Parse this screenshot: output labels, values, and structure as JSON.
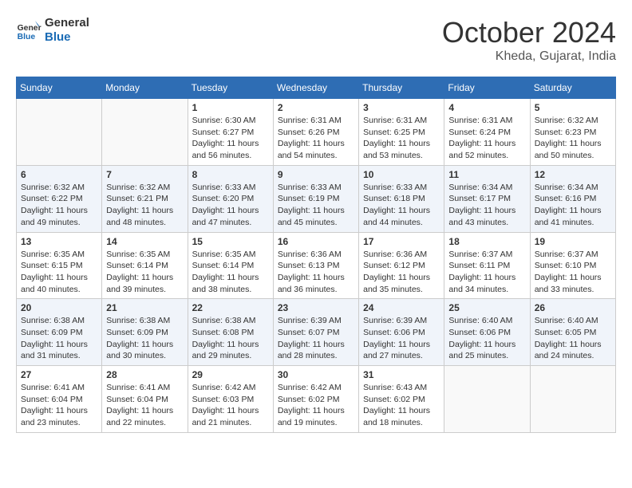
{
  "header": {
    "logo_general": "General",
    "logo_blue": "Blue",
    "month_title": "October 2024",
    "location": "Kheda, Gujarat, India"
  },
  "weekdays": [
    "Sunday",
    "Monday",
    "Tuesday",
    "Wednesday",
    "Thursday",
    "Friday",
    "Saturday"
  ],
  "weeks": [
    [
      {
        "day": "",
        "sunrise": "",
        "sunset": "",
        "daylight": ""
      },
      {
        "day": "",
        "sunrise": "",
        "sunset": "",
        "daylight": ""
      },
      {
        "day": "1",
        "sunrise": "Sunrise: 6:30 AM",
        "sunset": "Sunset: 6:27 PM",
        "daylight": "Daylight: 11 hours and 56 minutes."
      },
      {
        "day": "2",
        "sunrise": "Sunrise: 6:31 AM",
        "sunset": "Sunset: 6:26 PM",
        "daylight": "Daylight: 11 hours and 54 minutes."
      },
      {
        "day": "3",
        "sunrise": "Sunrise: 6:31 AM",
        "sunset": "Sunset: 6:25 PM",
        "daylight": "Daylight: 11 hours and 53 minutes."
      },
      {
        "day": "4",
        "sunrise": "Sunrise: 6:31 AM",
        "sunset": "Sunset: 6:24 PM",
        "daylight": "Daylight: 11 hours and 52 minutes."
      },
      {
        "day": "5",
        "sunrise": "Sunrise: 6:32 AM",
        "sunset": "Sunset: 6:23 PM",
        "daylight": "Daylight: 11 hours and 50 minutes."
      }
    ],
    [
      {
        "day": "6",
        "sunrise": "Sunrise: 6:32 AM",
        "sunset": "Sunset: 6:22 PM",
        "daylight": "Daylight: 11 hours and 49 minutes."
      },
      {
        "day": "7",
        "sunrise": "Sunrise: 6:32 AM",
        "sunset": "Sunset: 6:21 PM",
        "daylight": "Daylight: 11 hours and 48 minutes."
      },
      {
        "day": "8",
        "sunrise": "Sunrise: 6:33 AM",
        "sunset": "Sunset: 6:20 PM",
        "daylight": "Daylight: 11 hours and 47 minutes."
      },
      {
        "day": "9",
        "sunrise": "Sunrise: 6:33 AM",
        "sunset": "Sunset: 6:19 PM",
        "daylight": "Daylight: 11 hours and 45 minutes."
      },
      {
        "day": "10",
        "sunrise": "Sunrise: 6:33 AM",
        "sunset": "Sunset: 6:18 PM",
        "daylight": "Daylight: 11 hours and 44 minutes."
      },
      {
        "day": "11",
        "sunrise": "Sunrise: 6:34 AM",
        "sunset": "Sunset: 6:17 PM",
        "daylight": "Daylight: 11 hours and 43 minutes."
      },
      {
        "day": "12",
        "sunrise": "Sunrise: 6:34 AM",
        "sunset": "Sunset: 6:16 PM",
        "daylight": "Daylight: 11 hours and 41 minutes."
      }
    ],
    [
      {
        "day": "13",
        "sunrise": "Sunrise: 6:35 AM",
        "sunset": "Sunset: 6:15 PM",
        "daylight": "Daylight: 11 hours and 40 minutes."
      },
      {
        "day": "14",
        "sunrise": "Sunrise: 6:35 AM",
        "sunset": "Sunset: 6:14 PM",
        "daylight": "Daylight: 11 hours and 39 minutes."
      },
      {
        "day": "15",
        "sunrise": "Sunrise: 6:35 AM",
        "sunset": "Sunset: 6:14 PM",
        "daylight": "Daylight: 11 hours and 38 minutes."
      },
      {
        "day": "16",
        "sunrise": "Sunrise: 6:36 AM",
        "sunset": "Sunset: 6:13 PM",
        "daylight": "Daylight: 11 hours and 36 minutes."
      },
      {
        "day": "17",
        "sunrise": "Sunrise: 6:36 AM",
        "sunset": "Sunset: 6:12 PM",
        "daylight": "Daylight: 11 hours and 35 minutes."
      },
      {
        "day": "18",
        "sunrise": "Sunrise: 6:37 AM",
        "sunset": "Sunset: 6:11 PM",
        "daylight": "Daylight: 11 hours and 34 minutes."
      },
      {
        "day": "19",
        "sunrise": "Sunrise: 6:37 AM",
        "sunset": "Sunset: 6:10 PM",
        "daylight": "Daylight: 11 hours and 33 minutes."
      }
    ],
    [
      {
        "day": "20",
        "sunrise": "Sunrise: 6:38 AM",
        "sunset": "Sunset: 6:09 PM",
        "daylight": "Daylight: 11 hours and 31 minutes."
      },
      {
        "day": "21",
        "sunrise": "Sunrise: 6:38 AM",
        "sunset": "Sunset: 6:09 PM",
        "daylight": "Daylight: 11 hours and 30 minutes."
      },
      {
        "day": "22",
        "sunrise": "Sunrise: 6:38 AM",
        "sunset": "Sunset: 6:08 PM",
        "daylight": "Daylight: 11 hours and 29 minutes."
      },
      {
        "day": "23",
        "sunrise": "Sunrise: 6:39 AM",
        "sunset": "Sunset: 6:07 PM",
        "daylight": "Daylight: 11 hours and 28 minutes."
      },
      {
        "day": "24",
        "sunrise": "Sunrise: 6:39 AM",
        "sunset": "Sunset: 6:06 PM",
        "daylight": "Daylight: 11 hours and 27 minutes."
      },
      {
        "day": "25",
        "sunrise": "Sunrise: 6:40 AM",
        "sunset": "Sunset: 6:06 PM",
        "daylight": "Daylight: 11 hours and 25 minutes."
      },
      {
        "day": "26",
        "sunrise": "Sunrise: 6:40 AM",
        "sunset": "Sunset: 6:05 PM",
        "daylight": "Daylight: 11 hours and 24 minutes."
      }
    ],
    [
      {
        "day": "27",
        "sunrise": "Sunrise: 6:41 AM",
        "sunset": "Sunset: 6:04 PM",
        "daylight": "Daylight: 11 hours and 23 minutes."
      },
      {
        "day": "28",
        "sunrise": "Sunrise: 6:41 AM",
        "sunset": "Sunset: 6:04 PM",
        "daylight": "Daylight: 11 hours and 22 minutes."
      },
      {
        "day": "29",
        "sunrise": "Sunrise: 6:42 AM",
        "sunset": "Sunset: 6:03 PM",
        "daylight": "Daylight: 11 hours and 21 minutes."
      },
      {
        "day": "30",
        "sunrise": "Sunrise: 6:42 AM",
        "sunset": "Sunset: 6:02 PM",
        "daylight": "Daylight: 11 hours and 19 minutes."
      },
      {
        "day": "31",
        "sunrise": "Sunrise: 6:43 AM",
        "sunset": "Sunset: 6:02 PM",
        "daylight": "Daylight: 11 hours and 18 minutes."
      },
      {
        "day": "",
        "sunrise": "",
        "sunset": "",
        "daylight": ""
      },
      {
        "day": "",
        "sunrise": "",
        "sunset": "",
        "daylight": ""
      }
    ]
  ]
}
